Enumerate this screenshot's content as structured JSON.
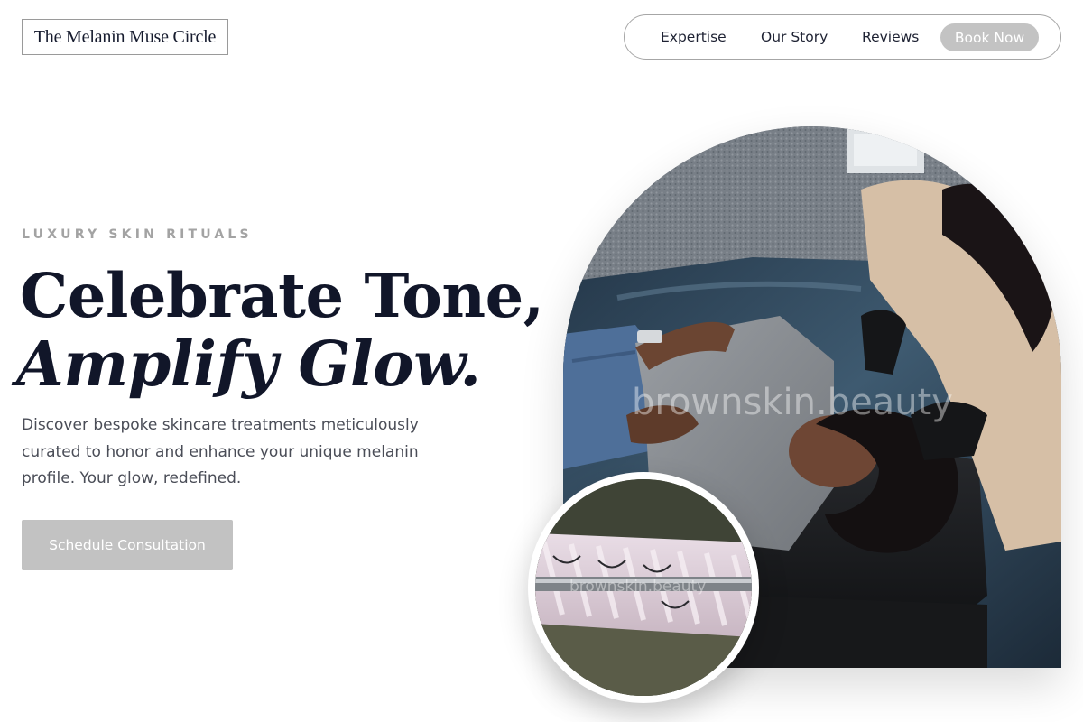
{
  "brand": {
    "name": "The Melanin Muse Circle"
  },
  "nav": {
    "links": [
      "Expertise",
      "Our Story",
      "Reviews"
    ],
    "cta": "Book Now"
  },
  "hero": {
    "eyebrow": "LUXURY SKIN RITUALS",
    "headline_line1": "Celebrate Tone,",
    "headline_line2": "Amplify Glow.",
    "description": "Discover bespoke skincare treatments meticulously curated to honor and enhance your unique melanin profile. Your glow, redefined.",
    "cta": "Schedule Consultation"
  },
  "images": {
    "main_watermark": "brownskin.beauty",
    "detail_watermark": "brownskin.beauty"
  },
  "colors": {
    "ink": "#111629",
    "eyebrow": "#a3a3a3",
    "body_text": "#4a4d57",
    "button_fill": "#c2c2c2",
    "outline": "#a6a6a6"
  }
}
